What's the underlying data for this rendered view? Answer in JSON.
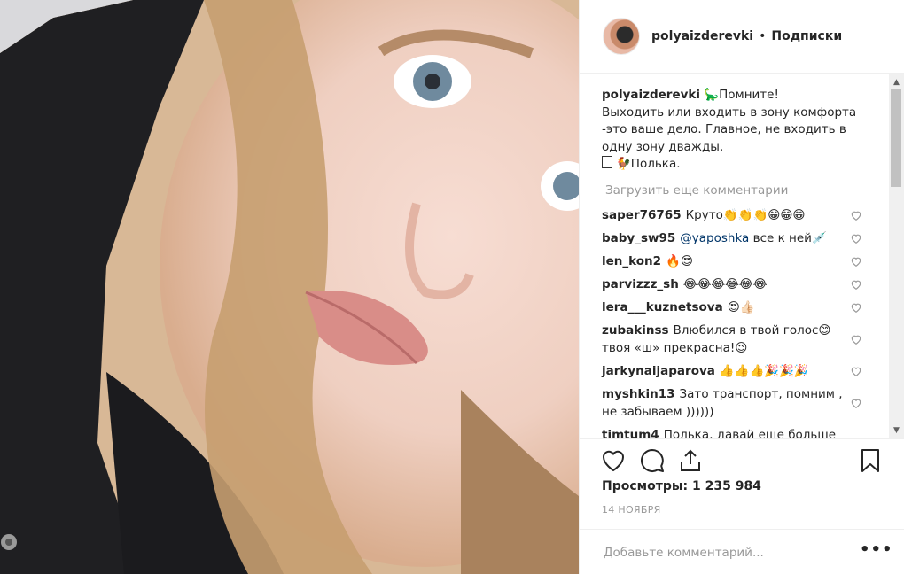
{
  "post": {
    "username": "polyaizderevki",
    "separator": "•",
    "follow_label": "Подписки"
  },
  "caption": {
    "username": "polyaizderevki",
    "line1": "🦕Помните!",
    "line2": "Выходить или входить в зону комфорта",
    "line3": "-это ваше дело. Главное, не входить в",
    "line4": "одну зону дважды.",
    "line5": "🐓Полька."
  },
  "load_more_label": "Загрузить еще комментарии",
  "comments": [
    {
      "user": "saper76765",
      "text": "Круто👏👏👏😁😁😁"
    },
    {
      "user": "baby_sw95",
      "mention": "@yaposhka",
      "text": " все к ней💉"
    },
    {
      "user": "len_kon2",
      "text": "🔥😍"
    },
    {
      "user": "parvizzz_sh",
      "text": "😂😂😂😂😂😂"
    },
    {
      "user": "lera___kuznetsova",
      "text": "😍👍🏻"
    },
    {
      "user": "zubakinss",
      "text": "Влюбился в твой голос😊",
      "text2": "твоя «ш» прекрасна!😉"
    },
    {
      "user": "jarkynaijaparova",
      "text": "👍👍👍🎉🎉🎉"
    },
    {
      "user": "myshkin13",
      "text": "Зато транспорт, помним ,",
      "text2": "не забываем ))))))"
    },
    {
      "user": "timtum4",
      "text": "Полька, давай еще больше"
    }
  ],
  "stats": {
    "views_label": "Просмотры: 1 235 984",
    "date": "14 НОЯБРЯ"
  },
  "comment_input": {
    "placeholder": "Добавьте комментарий..."
  },
  "more_label": "•••",
  "icons": {
    "like": "heart-icon",
    "comment": "comment-icon",
    "share": "share-icon",
    "save": "bookmark-icon"
  }
}
